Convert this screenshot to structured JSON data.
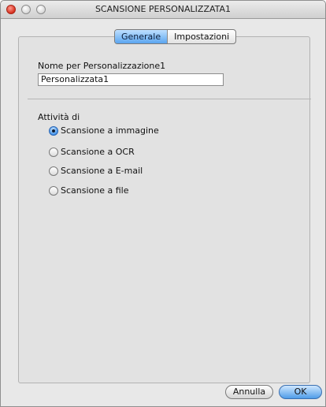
{
  "window": {
    "title": "SCANSIONE PERSONALIZZATA1"
  },
  "tabs": [
    {
      "label": "Generale",
      "active": true
    },
    {
      "label": "Impostazioni",
      "active": false
    }
  ],
  "name_field": {
    "label": "Nome per Personalizzazione1",
    "value": "Personalizzata1"
  },
  "activity": {
    "label": "Attività di",
    "options": [
      {
        "label": "Scansione a immagine",
        "selected": true
      },
      {
        "label": "Scansione a OCR",
        "selected": false
      },
      {
        "label": "Scansione a E-mail",
        "selected": false
      },
      {
        "label": "Scansione a file",
        "selected": false
      }
    ]
  },
  "buttons": {
    "cancel": "Annulla",
    "ok": "OK"
  },
  "colors": {
    "accent": "#4f9de8",
    "close_light": "#d72e1d"
  }
}
